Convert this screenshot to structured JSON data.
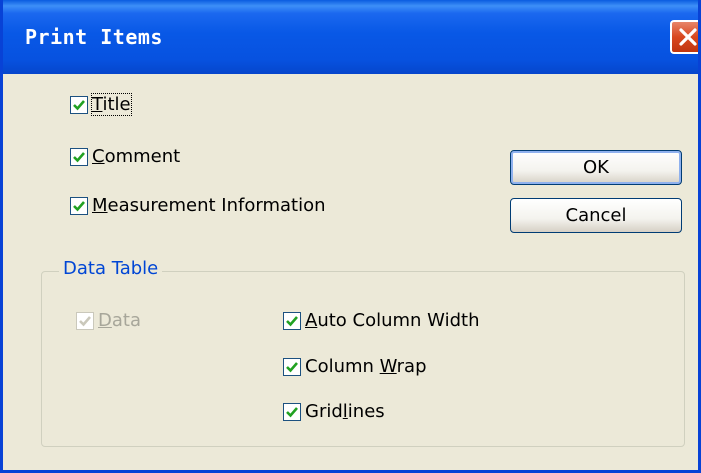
{
  "window": {
    "title": "Print Items"
  },
  "options": {
    "title": {
      "accel": "T",
      "rest": "itle",
      "checked": true
    },
    "comment": {
      "accel": "C",
      "rest": "omment",
      "checked": true
    },
    "measurement": {
      "accel": "M",
      "rest": "easurement Information",
      "checked": true
    }
  },
  "buttons": {
    "ok": "OK",
    "cancel": "Cancel"
  },
  "data_table": {
    "label": "Data Table",
    "data": {
      "accel": "D",
      "rest": "ata",
      "checked": true,
      "enabled": false
    },
    "auto_column_width": {
      "accel": "A",
      "rest": "uto Column Width",
      "checked": true
    },
    "column_wrap": {
      "before": "Column ",
      "accel": "W",
      "rest": "rap",
      "checked": true
    },
    "gridlines": {
      "before": "Grid",
      "accel": "l",
      "rest": "ines",
      "checked": true
    }
  },
  "colors": {
    "titlebar": "#0858e6",
    "face": "#ece9d8",
    "check": "#21a121",
    "group_label": "#0046d5"
  }
}
